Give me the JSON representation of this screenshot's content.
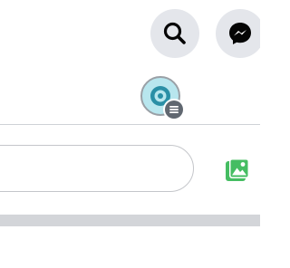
{
  "header": {
    "search_button": {
      "icon": "search-icon"
    },
    "messenger_button": {
      "icon": "messenger-icon"
    },
    "profile": {
      "avatar_icon": "avatar-icon",
      "badge_icon": "menu-icon"
    }
  },
  "composer": {
    "input_value": "",
    "photo_button": {
      "icon": "photo-icon",
      "color": "#45bd62"
    }
  },
  "colors": {
    "button_bg": "#e4e6eb",
    "icon_dark": "#050505",
    "avatar_bg": "#b8e6ee",
    "avatar_accent": "#2a8fa6",
    "divider": "#cfd2d6",
    "band": "#d3d5d9"
  }
}
